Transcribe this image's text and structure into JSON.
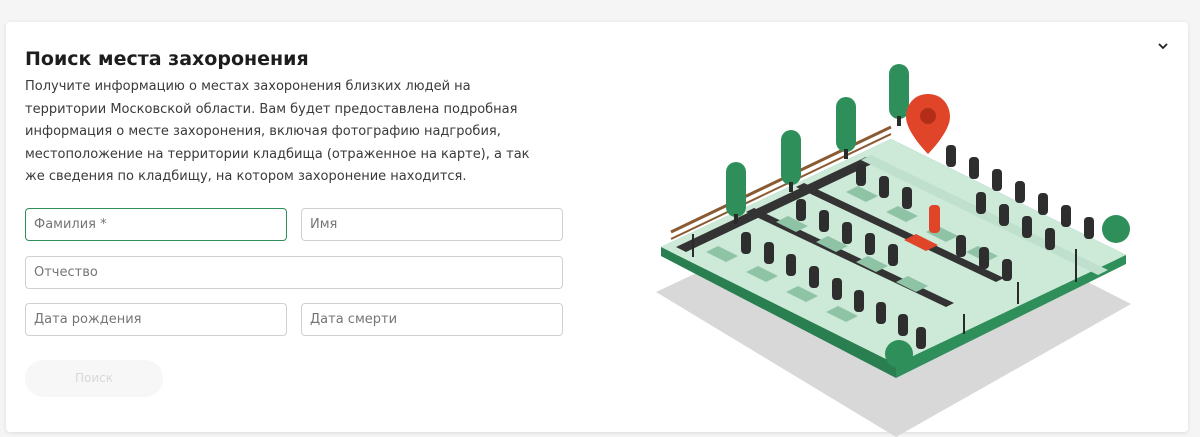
{
  "header": {
    "title": "Поиск места захоронения",
    "collapse_icon": "chevron-down-icon"
  },
  "description": "Получите информацию о местах захоронения близких людей на территории Московской области. Вам будет предоставлена подробная информация о месте захоронения, включая фотографию надгробия, местоположение на территории кладбища (отраженное на карте), а так же сведения по кладбищу, на котором захоронение находится.",
  "form": {
    "last_name_placeholder": "Фамилия *",
    "first_name_placeholder": "Имя",
    "middle_name_placeholder": "Отчество",
    "birth_date_placeholder": "Дата рождения",
    "death_date_placeholder": "Дата смерти",
    "search_label": "Поиск"
  },
  "colors": {
    "accent": "#2f8f5b",
    "marker": "#e0452a",
    "ground": "#cde9d8"
  }
}
